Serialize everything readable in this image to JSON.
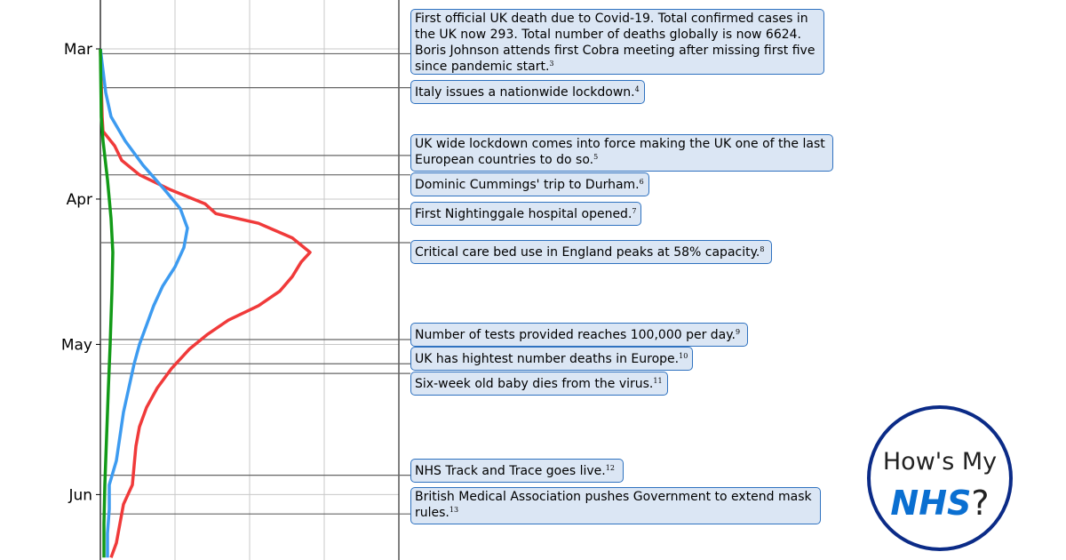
{
  "chart_data": {
    "type": "line",
    "y_axis": {
      "ticks": [
        "Mar",
        "Apr",
        "May",
        "Jun"
      ],
      "orientation": "dates-downward"
    },
    "x_axis": {
      "ticks": [],
      "grid": true
    },
    "colors": {
      "red": "#f03a3a",
      "blue": "#3d9bf0",
      "green": "#129a17"
    },
    "series": [
      {
        "color": "red",
        "points": [
          {
            "date": "2020-03-01",
            "value": 0
          },
          {
            "date": "2020-03-15",
            "value": 0.1
          },
          {
            "date": "2020-03-18",
            "value": 0.15
          },
          {
            "date": "2020-03-21",
            "value": 0.8
          },
          {
            "date": "2020-03-24",
            "value": 1.2
          },
          {
            "date": "2020-03-27",
            "value": 2.2
          },
          {
            "date": "2020-03-30",
            "value": 3.9
          },
          {
            "date": "2020-04-02",
            "value": 5.9
          },
          {
            "date": "2020-04-04",
            "value": 6.5
          },
          {
            "date": "2020-04-06",
            "value": 8.9
          },
          {
            "date": "2020-04-09",
            "value": 10.8
          },
          {
            "date": "2020-04-12",
            "value": 11.8
          },
          {
            "date": "2020-04-14",
            "value": 11.3
          },
          {
            "date": "2020-04-17",
            "value": 10.8
          },
          {
            "date": "2020-04-20",
            "value": 10.1
          },
          {
            "date": "2020-04-23",
            "value": 8.9
          },
          {
            "date": "2020-04-26",
            "value": 7.2
          },
          {
            "date": "2020-04-29",
            "value": 6.0
          },
          {
            "date": "2020-05-02",
            "value": 5.0
          },
          {
            "date": "2020-05-06",
            "value": 4.0
          },
          {
            "date": "2020-05-10",
            "value": 3.2
          },
          {
            "date": "2020-05-14",
            "value": 2.6
          },
          {
            "date": "2020-05-18",
            "value": 2.2
          },
          {
            "date": "2020-05-22",
            "value": 2.0
          },
          {
            "date": "2020-05-26",
            "value": 1.9
          },
          {
            "date": "2020-05-30",
            "value": 1.8
          },
          {
            "date": "2020-06-03",
            "value": 1.3
          },
          {
            "date": "2020-06-07",
            "value": 1.1
          },
          {
            "date": "2020-06-11",
            "value": 0.9
          },
          {
            "date": "2020-06-14",
            "value": 0.6
          }
        ]
      },
      {
        "color": "blue",
        "points": [
          {
            "date": "2020-03-01",
            "value": 0
          },
          {
            "date": "2020-03-10",
            "value": 0.3
          },
          {
            "date": "2020-03-15",
            "value": 0.6
          },
          {
            "date": "2020-03-20",
            "value": 1.4
          },
          {
            "date": "2020-03-25",
            "value": 2.4
          },
          {
            "date": "2020-03-30",
            "value": 3.6
          },
          {
            "date": "2020-04-03",
            "value": 4.5
          },
          {
            "date": "2020-04-07",
            "value": 4.9
          },
          {
            "date": "2020-04-11",
            "value": 4.7
          },
          {
            "date": "2020-04-15",
            "value": 4.2
          },
          {
            "date": "2020-04-19",
            "value": 3.5
          },
          {
            "date": "2020-04-23",
            "value": 3.0
          },
          {
            "date": "2020-04-27",
            "value": 2.6
          },
          {
            "date": "2020-05-01",
            "value": 2.2
          },
          {
            "date": "2020-05-05",
            "value": 1.9
          },
          {
            "date": "2020-05-10",
            "value": 1.6
          },
          {
            "date": "2020-05-15",
            "value": 1.3
          },
          {
            "date": "2020-05-20",
            "value": 1.1
          },
          {
            "date": "2020-05-25",
            "value": 0.9
          },
          {
            "date": "2020-05-30",
            "value": 0.5
          },
          {
            "date": "2020-06-04",
            "value": 0.5
          },
          {
            "date": "2020-06-09",
            "value": 0.4
          },
          {
            "date": "2020-06-14",
            "value": 0.4
          }
        ]
      },
      {
        "color": "green",
        "points": [
          {
            "date": "2020-03-01",
            "value": 0
          },
          {
            "date": "2020-03-15",
            "value": 0.05
          },
          {
            "date": "2020-03-20",
            "value": 0.15
          },
          {
            "date": "2020-03-28",
            "value": 0.4
          },
          {
            "date": "2020-04-05",
            "value": 0.6
          },
          {
            "date": "2020-04-12",
            "value": 0.7
          },
          {
            "date": "2020-04-20",
            "value": 0.65
          },
          {
            "date": "2020-05-01",
            "value": 0.55
          },
          {
            "date": "2020-05-10",
            "value": 0.45
          },
          {
            "date": "2020-05-20",
            "value": 0.35
          },
          {
            "date": "2020-05-30",
            "value": 0.25
          },
          {
            "date": "2020-06-07",
            "value": 0.2
          },
          {
            "date": "2020-06-14",
            "value": 0.2
          }
        ]
      }
    ],
    "annotations": [
      {
        "date": "2020-03-02",
        "text": "First official UK death due to Covid-19. Total confirmed cases in the UK now 293. Total number of deaths globally is now 6624. Boris Johnson attends first Cobra meeting after missing first five since pandemic start.",
        "ref": "3"
      },
      {
        "date": "2020-03-09",
        "text": "Italy issues a nationwide lockdown.",
        "ref": "4"
      },
      {
        "date": "2020-03-23",
        "text": "UK wide lockdown comes into force making the UK one of the last European countries to do so.",
        "ref": "5"
      },
      {
        "date": "2020-03-27",
        "text": "Dominic Cummings' trip to Durham.",
        "ref": "6"
      },
      {
        "date": "2020-04-03",
        "text": "First Nightinggale hospital opened.",
        "ref": "7"
      },
      {
        "date": "2020-04-10",
        "text": "Critical care bed use in England peaks at 58% capacity.",
        "ref": "8"
      },
      {
        "date": "2020-04-30",
        "text": "Number of tests provided reaches 100,000 per day.",
        "ref": "9"
      },
      {
        "date": "2020-05-05",
        "text": "UK has hightest number deaths in Europe.",
        "ref": "10"
      },
      {
        "date": "2020-05-07",
        "text": "Six-week old baby dies from the virus.",
        "ref": "11"
      },
      {
        "date": "2020-05-28",
        "text": "NHS Track and Trace goes live.",
        "ref": "12"
      },
      {
        "date": "2020-06-05",
        "text": "British Medical Association pushes Government to extend mask rules.",
        "ref": "13"
      }
    ]
  },
  "logo": {
    "line1": "How's My",
    "nhs": "NHS",
    "suffix": "?"
  }
}
